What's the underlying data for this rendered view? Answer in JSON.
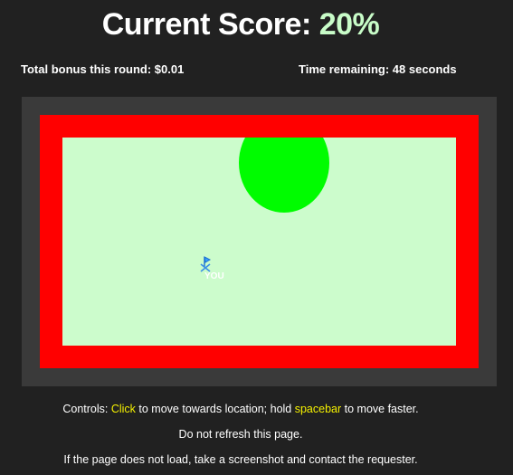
{
  "header": {
    "score_label": "Current Score: ",
    "score_value": "20%",
    "bonus_text": "Total bonus this round: $0.01",
    "time_text": "Time remaining: 48 seconds"
  },
  "game": {
    "player_label": "YOU"
  },
  "footer": {
    "controls_prefix": "Controls: ",
    "click_word": "Click",
    "controls_middle": " to move towards location; hold ",
    "spacebar_word": "spacebar",
    "controls_suffix": " to move faster.",
    "no_refresh": "Do not refresh this page.",
    "load_help": "If the page does not load, take a screenshot and contact the requester."
  },
  "colors": {
    "background": "#212121",
    "score_value": "#c8fcc8",
    "boundary": "#ff0000",
    "field": "#ccfccc",
    "target": "#00fc00",
    "highlight": "#f4f000"
  },
  "icons": {
    "player": "player-marker-icon"
  }
}
